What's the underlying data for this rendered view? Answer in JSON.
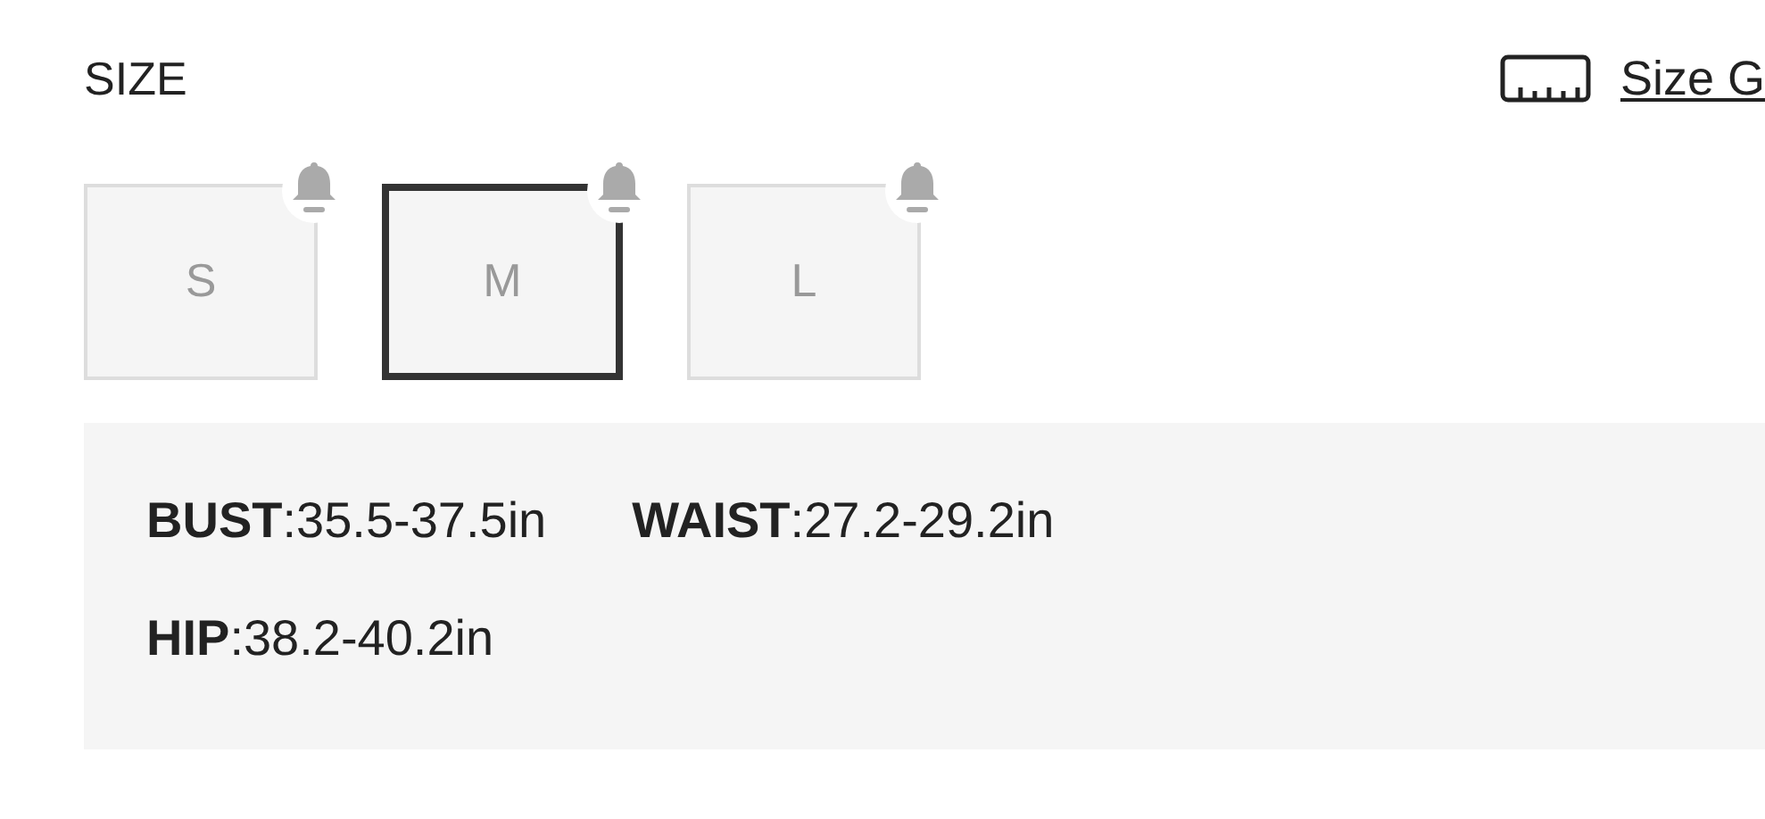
{
  "heading": "SIZE",
  "size_guide_link": "Size G",
  "sizes": [
    {
      "label": "S",
      "selected": false
    },
    {
      "label": "M",
      "selected": true
    },
    {
      "label": "L",
      "selected": false
    }
  ],
  "measurements": [
    [
      "**BUST**:35.5-37.5in",
      "**WAIST**:27.2-29.2in"
    ],
    [
      "**HIP**:38.2-40.2in"
    ]
  ]
}
